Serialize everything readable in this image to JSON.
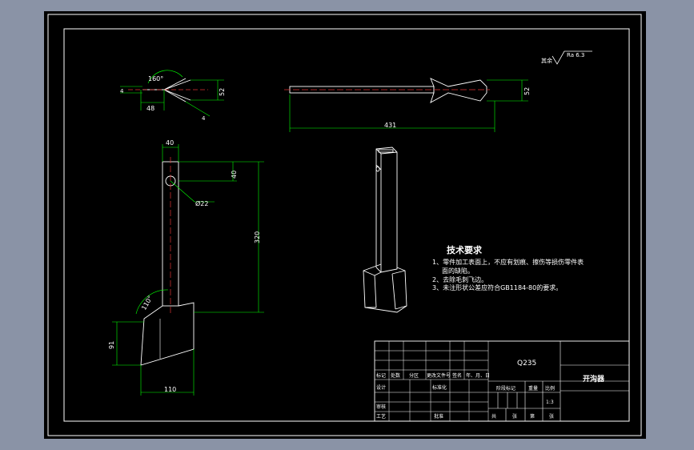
{
  "drawing": {
    "roughness_symbol": {
      "prefix": "其余",
      "label": "Ra 6.3"
    },
    "top_view_left": {
      "angle_label": "160°",
      "dims": {
        "left_thickness": "4",
        "bottom_length": "48",
        "height": "52",
        "blade_thickness": "4"
      }
    },
    "top_view_right": {
      "dims": {
        "height": "52",
        "length": "431"
      }
    },
    "front_view": {
      "dims": {
        "top_width": "40",
        "hole_offset": "40",
        "hole_dia": "Ø22",
        "shaft_length": "320",
        "angle": "110°",
        "blade_height": "91",
        "blade_width": "110"
      }
    },
    "technical_requirements": {
      "title": "技术要求",
      "items": [
        "1、零件加工表面上，不应有划痕、擦伤等损伤零件表",
        "面的缺陷。",
        "2、去除毛刺飞边。",
        "3、未注形状公差应符合GB1184-80的要求。"
      ]
    },
    "title_block": {
      "material": "Q235",
      "part_name": "开沟器",
      "row_labels": [
        "标记",
        "处数",
        "分区",
        "更改文件号",
        "签名",
        "年、月、日"
      ],
      "designer_label": "设计",
      "standardization_label": "标准化",
      "stage_mark_label": "阶段标记",
      "weight_label": "重量",
      "scale_label": "比例",
      "scale_value": "1:3",
      "review_label": "审核",
      "process_label": "工艺",
      "approve_label": "批准",
      "sheet_labels": [
        "共",
        "张",
        "第",
        "张"
      ]
    }
  }
}
